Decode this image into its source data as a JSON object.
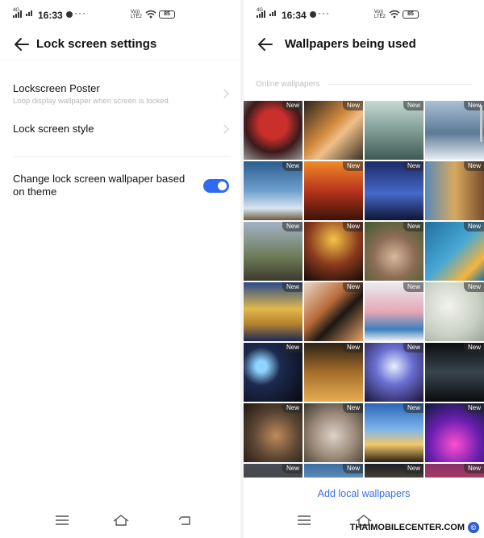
{
  "left": {
    "status": {
      "network": "4G",
      "time": "16:33",
      "battery": "85"
    },
    "title": "Lock screen settings",
    "items": [
      {
        "label": "Lockscreen Poster",
        "sub": "Loop display wallpaper when screen is locked."
      },
      {
        "label": "Lock screen style"
      }
    ],
    "toggle": {
      "label": "Change lock screen wallpaper based on theme",
      "on": true
    }
  },
  "right": {
    "status": {
      "network": "4G",
      "time": "16:34",
      "battery": "85"
    },
    "title": "Wallpapers being used",
    "section": "Online wallpapers",
    "badge": "New",
    "add_link": "Add local wallpapers"
  },
  "watermark": {
    "text": "THAIMOBILECENTER.COM",
    "symbol": "©"
  },
  "colors": {
    "accent": "#2f6bf0",
    "link": "#3a6ff2"
  }
}
